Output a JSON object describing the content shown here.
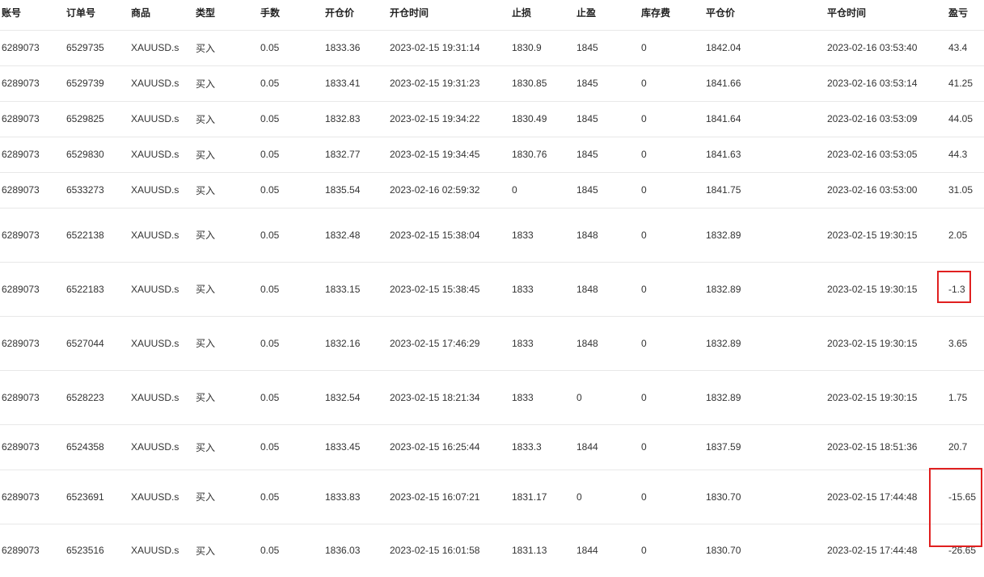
{
  "headers": [
    "账号",
    "订单号",
    "商品",
    "类型",
    "手数",
    "开仓价",
    "开仓时间",
    "止损",
    "止盈",
    "库存费",
    "平仓价",
    "平仓时间",
    "盈亏"
  ],
  "rows": [
    [
      "6289073",
      "6529735",
      "XAUUSD.s",
      "买入",
      "0.05",
      "1833.36",
      "2023-02-15 19:31:14",
      "1830.9",
      "1845",
      "0",
      "1842.04",
      "2023-02-16 03:53:40",
      "43.4"
    ],
    [
      "6289073",
      "6529739",
      "XAUUSD.s",
      "买入",
      "0.05",
      "1833.41",
      "2023-02-15 19:31:23",
      "1830.85",
      "1845",
      "0",
      "1841.66",
      "2023-02-16 03:53:14",
      "41.25"
    ],
    [
      "6289073",
      "6529825",
      "XAUUSD.s",
      "买入",
      "0.05",
      "1832.83",
      "2023-02-15 19:34:22",
      "1830.49",
      "1845",
      "0",
      "1841.64",
      "2023-02-16 03:53:09",
      "44.05"
    ],
    [
      "6289073",
      "6529830",
      "XAUUSD.s",
      "买入",
      "0.05",
      "1832.77",
      "2023-02-15 19:34:45",
      "1830.76",
      "1845",
      "0",
      "1841.63",
      "2023-02-16 03:53:05",
      "44.3"
    ],
    [
      "6289073",
      "6533273",
      "XAUUSD.s",
      "买入",
      "0.05",
      "1835.54",
      "2023-02-16 02:59:32",
      "0",
      "1845",
      "0",
      "1841.75",
      "2023-02-16 03:53:00",
      "31.05"
    ],
    [
      "6289073",
      "6522138",
      "XAUUSD.s",
      "买入",
      "0.05",
      "1832.48",
      "2023-02-15 15:38:04",
      "1833",
      "1848",
      "0",
      "1832.89",
      "2023-02-15 19:30:15",
      "2.05"
    ],
    [
      "6289073",
      "6522183",
      "XAUUSD.s",
      "买入",
      "0.05",
      "1833.15",
      "2023-02-15 15:38:45",
      "1833",
      "1848",
      "0",
      "1832.89",
      "2023-02-15 19:30:15",
      "-1.3"
    ],
    [
      "6289073",
      "6527044",
      "XAUUSD.s",
      "买入",
      "0.05",
      "1832.16",
      "2023-02-15 17:46:29",
      "1833",
      "1848",
      "0",
      "1832.89",
      "2023-02-15 19:30:15",
      "3.65"
    ],
    [
      "6289073",
      "6528223",
      "XAUUSD.s",
      "买入",
      "0.05",
      "1832.54",
      "2023-02-15 18:21:34",
      "1833",
      "0",
      "0",
      "1832.89",
      "2023-02-15 19:30:15",
      "1.75"
    ],
    [
      "6289073",
      "6524358",
      "XAUUSD.s",
      "买入",
      "0.05",
      "1833.45",
      "2023-02-15 16:25:44",
      "1833.3",
      "1844",
      "0",
      "1837.59",
      "2023-02-15 18:51:36",
      "20.7"
    ],
    [
      "6289073",
      "6523691",
      "XAUUSD.s",
      "买入",
      "0.05",
      "1833.83",
      "2023-02-15 16:07:21",
      "1831.17",
      "0",
      "0",
      "1830.70",
      "2023-02-15 17:44:48",
      "-15.65"
    ],
    [
      "6289073",
      "6523516",
      "XAUUSD.s",
      "买入",
      "0.05",
      "1836.03",
      "2023-02-15 16:01:58",
      "1831.13",
      "1844",
      "0",
      "1830.70",
      "2023-02-15 17:44:48",
      "-26.65"
    ]
  ],
  "colors": {
    "highlight": "#e02020",
    "row_border": "#e8e8e8"
  }
}
